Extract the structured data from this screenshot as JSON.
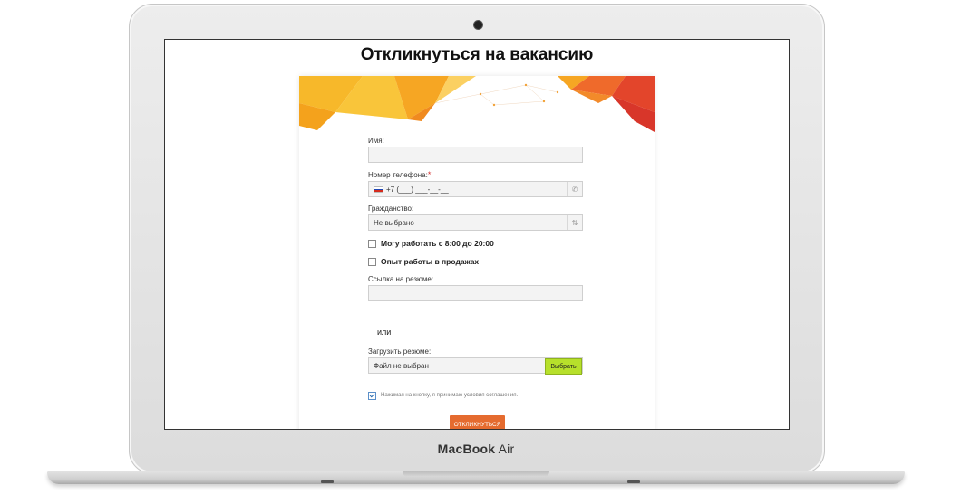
{
  "page": {
    "title": "Откликнуться на вакансию"
  },
  "laptop": {
    "brand_bold": "MacBook",
    "brand_light": " Air"
  },
  "form": {
    "name_label": "Имя:",
    "name_value": "",
    "phone_label": "Номер телефона:",
    "phone_required": "*",
    "phone_value": "+7 (___) ___-__-__",
    "citizenship_label": "Гражданство:",
    "citizenship_value": "Не выбрано",
    "work_hours_label": "Могу работать с 8:00 до 20:00",
    "work_hours_checked": false,
    "sales_exp_label": "Опыт работы в продажах",
    "sales_exp_checked": false,
    "resume_link_label": "Ссылка на резюме:",
    "resume_link_value": "",
    "or_text": "или",
    "upload_label": "Загрузить резюме:",
    "upload_value": "Файл не выбран",
    "upload_button": "Выбрать",
    "agreement_text": "Нажимая на кнопку, я принимаю условия соглашения.",
    "agreement_checked": true,
    "submit_label": "ОТКЛИКНУТЬСЯ"
  },
  "icons": {
    "phone": "phone-icon",
    "select_arrows": "updown-arrows-icon",
    "flag": "russia-flag-icon"
  },
  "colors": {
    "submit": "#e56b2f",
    "upload_button": "#b7e02b",
    "banner_orange": "#f5a623",
    "banner_red": "#d8432a",
    "required": "#d32f2f"
  }
}
